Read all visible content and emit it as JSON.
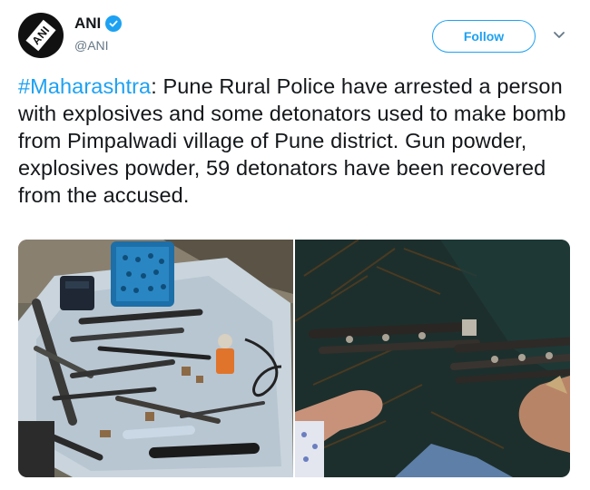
{
  "account": {
    "display_name": "ANI",
    "handle": "@ANI",
    "avatar_text": "ANI",
    "verified": true
  },
  "actions": {
    "follow_label": "Follow"
  },
  "tweet": {
    "hashtag": "#Maharashtra",
    "body": ": Pune Rural Police have arrested a person with explosives and some detonators used to make bomb from Pimpalwadi village of Pune district. Gun powder, explosives powder, 59 detonators have been recovered from the accused."
  },
  "colors": {
    "accent": "#1da1f2",
    "text": "#14171a",
    "secondary": "#657786"
  },
  "icons": {
    "verified": "verified-badge-icon",
    "more": "chevron-down-icon"
  }
}
